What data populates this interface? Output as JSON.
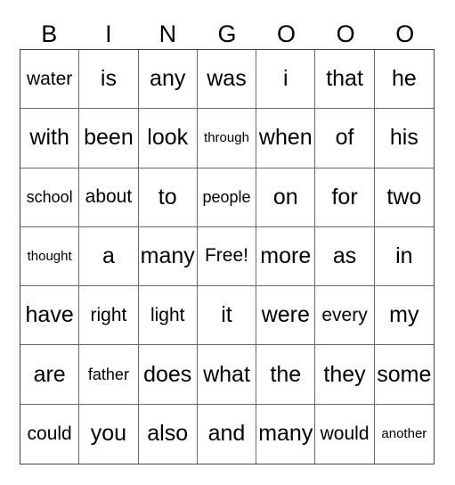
{
  "header": [
    "B",
    "I",
    "N",
    "G",
    "O",
    "O",
    "O"
  ],
  "rows": [
    [
      "water",
      "is",
      "any",
      "was",
      "i",
      "that",
      "he"
    ],
    [
      "with",
      "been",
      "look",
      "through",
      "when",
      "of",
      "his"
    ],
    [
      "school",
      "about",
      "to",
      "people",
      "on",
      "for",
      "two"
    ],
    [
      "thought",
      "a",
      "many",
      "Free!",
      "more",
      "as",
      "in"
    ],
    [
      "have",
      "right",
      "light",
      "it",
      "were",
      "every",
      "my"
    ],
    [
      "are",
      "father",
      "does",
      "what",
      "the",
      "they",
      "some"
    ],
    [
      "could",
      "you",
      "also",
      "and",
      "many",
      "would",
      "another"
    ]
  ]
}
